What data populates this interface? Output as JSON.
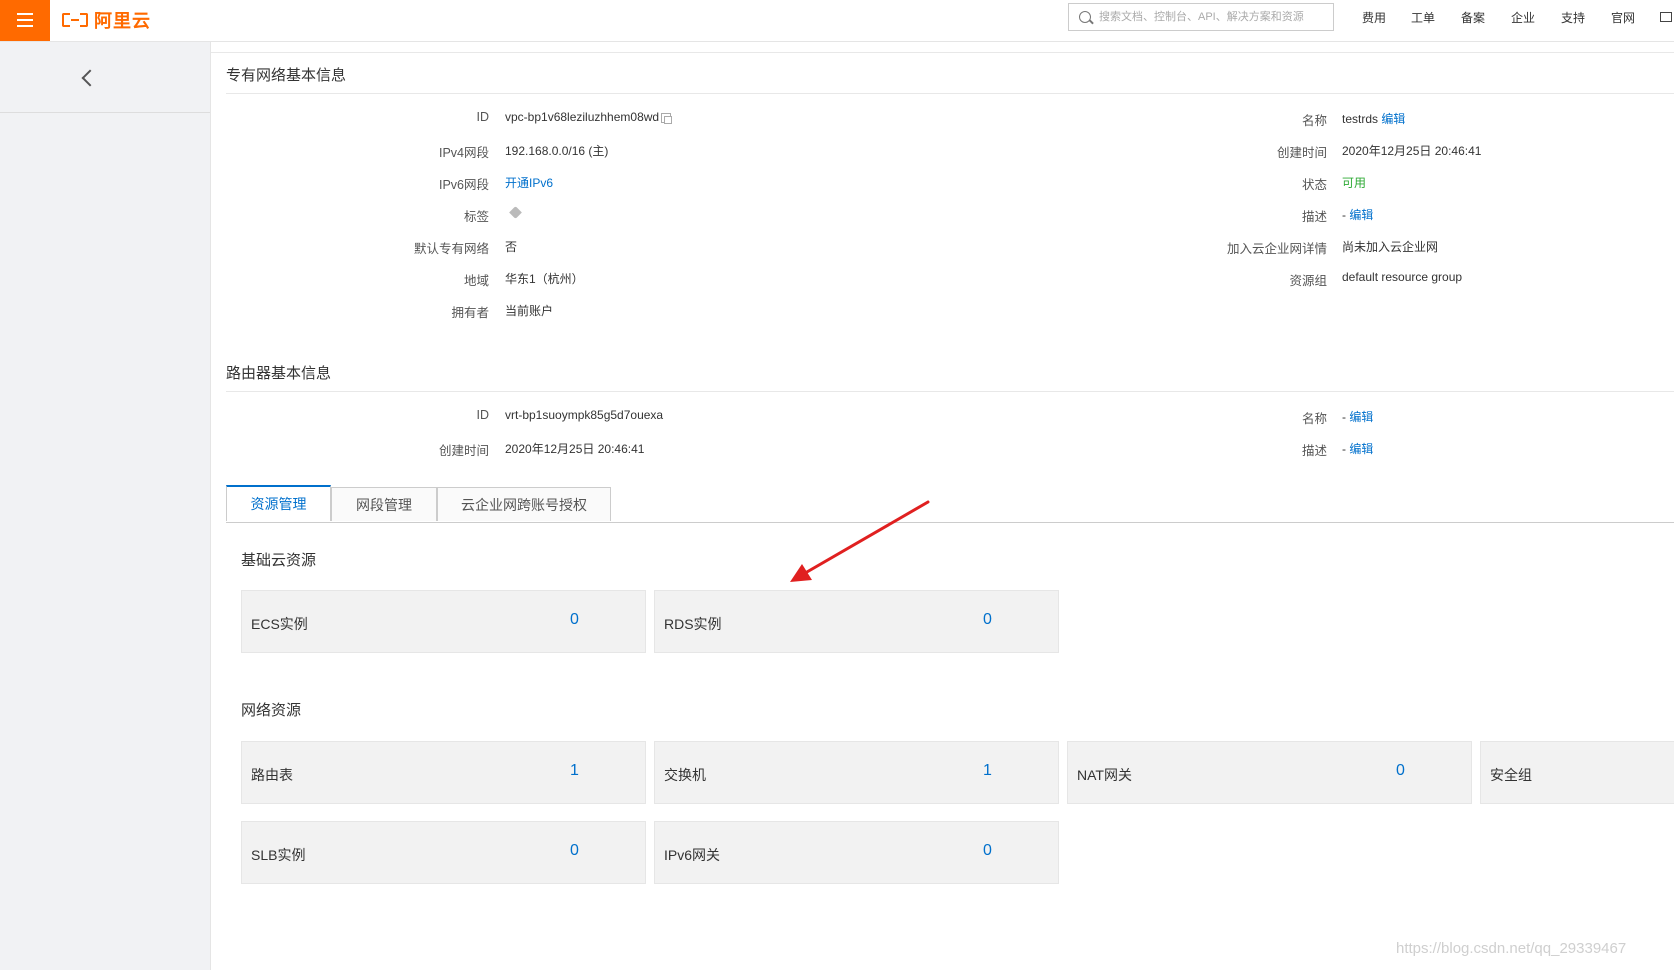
{
  "header": {
    "logo_text": "阿里云",
    "search_placeholder": "搜索文档、控制台、API、解决方案和资源",
    "nav": [
      "费用",
      "工单",
      "备案",
      "企业",
      "支持",
      "官网"
    ]
  },
  "vpc_section": {
    "title": "专有网络基本信息",
    "left": [
      {
        "label": "ID",
        "value": "vpc-bp1v68leziluzhhem08wd"
      },
      {
        "label": "IPv4网段",
        "value": "192.168.0.0/16 (主)"
      },
      {
        "label": "IPv6网段",
        "value": "开通IPv6"
      },
      {
        "label": "标签",
        "value": ""
      },
      {
        "label": "默认专有网络",
        "value": "否"
      },
      {
        "label": "地域",
        "value": "华东1（杭州）"
      },
      {
        "label": "拥有者",
        "value": "当前账户"
      }
    ],
    "right": [
      {
        "label": "名称",
        "value": "testrds",
        "edit": "编辑"
      },
      {
        "label": "创建时间",
        "value": "2020年12月25日 20:46:41"
      },
      {
        "label": "状态",
        "value": "可用"
      },
      {
        "label": "描述",
        "value": "-",
        "edit": "编辑"
      },
      {
        "label": "加入云企业网详情",
        "value": "尚未加入云企业网"
      },
      {
        "label": "资源组",
        "value": "default resource group"
      }
    ]
  },
  "router_section": {
    "title": "路由器基本信息",
    "left": [
      {
        "label": "ID",
        "value": "vrt-bp1suoympk85g5d7ouexa"
      },
      {
        "label": "创建时间",
        "value": "2020年12月25日 20:46:41"
      }
    ],
    "right": [
      {
        "label": "名称",
        "value": "-",
        "edit": "编辑"
      },
      {
        "label": "描述",
        "value": "-",
        "edit": "编辑"
      }
    ]
  },
  "tabs": [
    "资源管理",
    "网段管理",
    "云企业网跨账号授权"
  ],
  "basic_resources": {
    "title": "基础云资源",
    "cards": [
      {
        "label": "ECS实例",
        "count": "0"
      },
      {
        "label": "RDS实例",
        "count": "0"
      }
    ]
  },
  "network_resources": {
    "title": "网络资源",
    "cards": [
      {
        "label": "路由表",
        "count": "1"
      },
      {
        "label": "交换机",
        "count": "1"
      },
      {
        "label": "NAT网关",
        "count": "0"
      },
      {
        "label": "安全组",
        "count": ""
      },
      {
        "label": "SLB实例",
        "count": "0"
      },
      {
        "label": "IPv6网关",
        "count": "0"
      }
    ]
  },
  "watermark": "https://blog.csdn.net/qq_29339467",
  "colors": {
    "brand": "#ff6a00",
    "link": "#0070cc",
    "status_ok": "#2eaa35",
    "annotation_arrow": "#e02020"
  }
}
